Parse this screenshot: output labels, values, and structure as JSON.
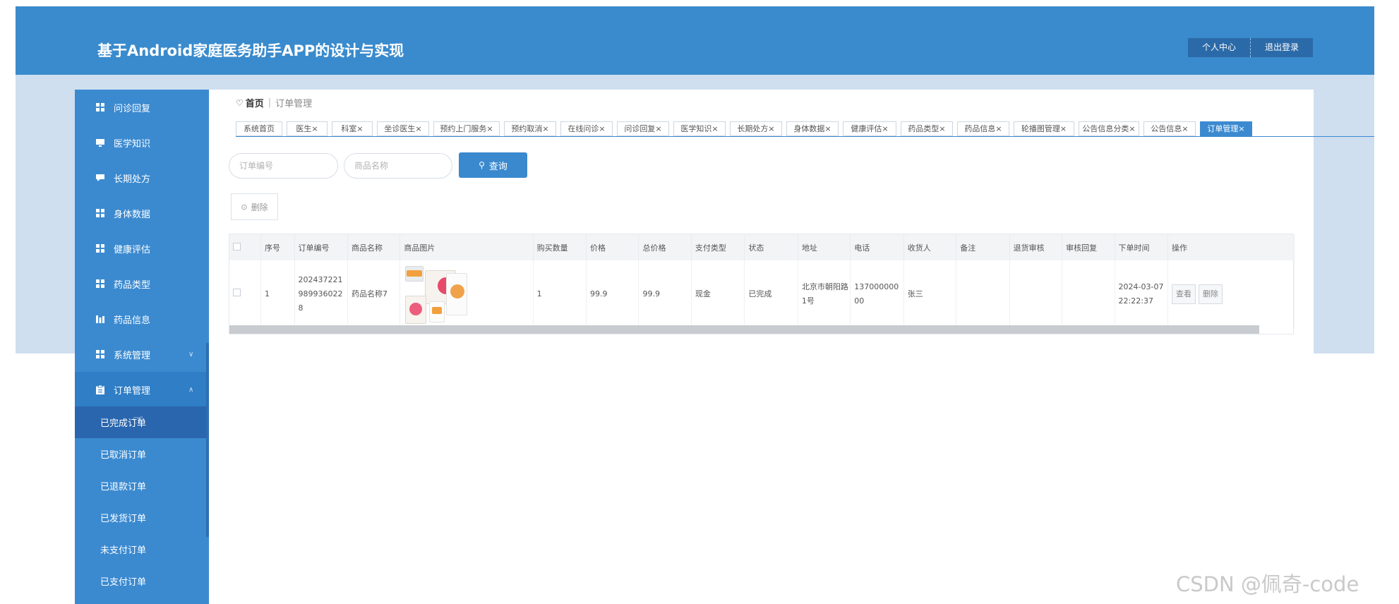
{
  "app": {
    "title": "基于Android家庭医务助手APP的设计与实现",
    "header_buttons": [
      "个人中心",
      "退出登录"
    ]
  },
  "sidebar": {
    "items": [
      {
        "label": "问诊回复",
        "icon": "grid-icon"
      },
      {
        "label": "医学知识",
        "icon": "monitor-icon"
      },
      {
        "label": "长期处方",
        "icon": "comment-icon"
      },
      {
        "label": "身体数据",
        "icon": "grid-icon"
      },
      {
        "label": "健康评估",
        "icon": "grid-icon"
      },
      {
        "label": "药品类型",
        "icon": "grid-icon"
      },
      {
        "label": "药品信息",
        "icon": "chart-icon"
      },
      {
        "label": "系统管理",
        "icon": "grid-icon"
      },
      {
        "label": "订单管理",
        "icon": "clipboard-icon"
      }
    ],
    "submenu": [
      "已完成订单",
      "已取消订单",
      "已退款订单",
      "已发货订单",
      "未支付订单",
      "已支付订单"
    ],
    "active_submenu": "已完成订单"
  },
  "breadcrumb": {
    "home": "首页",
    "current": "订单管理"
  },
  "tabs": [
    "系统首页",
    "医生×",
    "科室×",
    "坐诊医生×",
    "预约上门服务×",
    "预约取消×",
    "在线问诊×",
    "问诊回复×",
    "医学知识×",
    "长期处方×",
    "身体数据×",
    "健康评估×",
    "药品类型×",
    "药品信息×",
    "轮播图管理×",
    "公告信息分类×",
    "公告信息×",
    "订单管理×"
  ],
  "active_tab": "订单管理×",
  "search": {
    "order_no_placeholder": "订单编号",
    "product_name_placeholder": "商品名称",
    "query_label": "查询"
  },
  "actions": {
    "delete_label": "删除"
  },
  "table": {
    "columns": [
      "序号",
      "订单编号",
      "商品名称",
      "商品图片",
      "购买数量",
      "价格",
      "总价格",
      "支付类型",
      "状态",
      "地址",
      "电话",
      "收货人",
      "备注",
      "退货审核",
      "审核回复",
      "下单时间",
      "操作"
    ],
    "rows": [
      {
        "index": "1",
        "order_no": "2024372219899360228",
        "product_name": "药品名称7",
        "quantity": "1",
        "price": "99.9",
        "total": "99.9",
        "pay_type": "现金",
        "status": "已完成",
        "address": "北京市朝阳路1号",
        "phone": "13700000000",
        "receiver": "张三",
        "remark": "",
        "return_review": "",
        "review_reply": "",
        "order_time": "2024-03-07 22:22:37",
        "view_label": "查看",
        "delete_label": "删除"
      }
    ]
  },
  "watermark": "CSDN @佩奇-code",
  "colors": {
    "primary": "#3b8ad0",
    "header": "#3a8bcd",
    "active_submenu": "#2a66ad"
  }
}
